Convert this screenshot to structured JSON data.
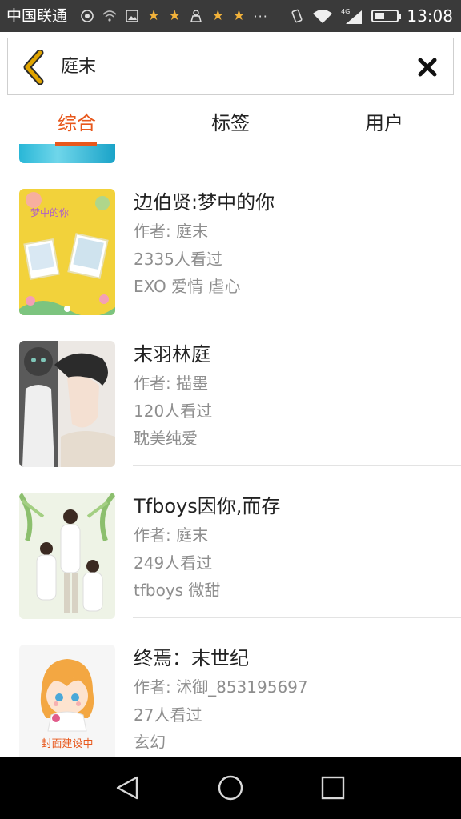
{
  "status_bar": {
    "carrier": "中国联通",
    "network": "4G",
    "time": "13:08",
    "battery_level": 0.45
  },
  "search": {
    "query": "庭末"
  },
  "tabs": [
    {
      "label": "综合",
      "active": true
    },
    {
      "label": "标签",
      "active": false
    },
    {
      "label": "用户",
      "active": false
    }
  ],
  "results": [
    {
      "title": "边伯贤:梦中的你",
      "author": "作者: 庭末",
      "views": "2335人看过",
      "tags": "EXO 爱情 虐心",
      "cover_text": "梦中的你"
    },
    {
      "title": "末羽林庭",
      "author": "作者: 描墨",
      "views": "120人看过",
      "tags": "耽美纯爱"
    },
    {
      "title": "Tfboys因你,而存",
      "author": "作者: 庭末",
      "views": "249人看过",
      "tags": "tfboys 微甜"
    },
    {
      "title": "终焉：末世纪",
      "author": "作者: 沭御_853195697",
      "views": "27人看过",
      "tags": "玄幻",
      "cover_text": "封面建设中"
    }
  ],
  "colors": {
    "accent": "#e8581c",
    "status_bar": "#3a3a3a",
    "nav_bar": "#000000",
    "back_arrow": "#e0a400"
  }
}
